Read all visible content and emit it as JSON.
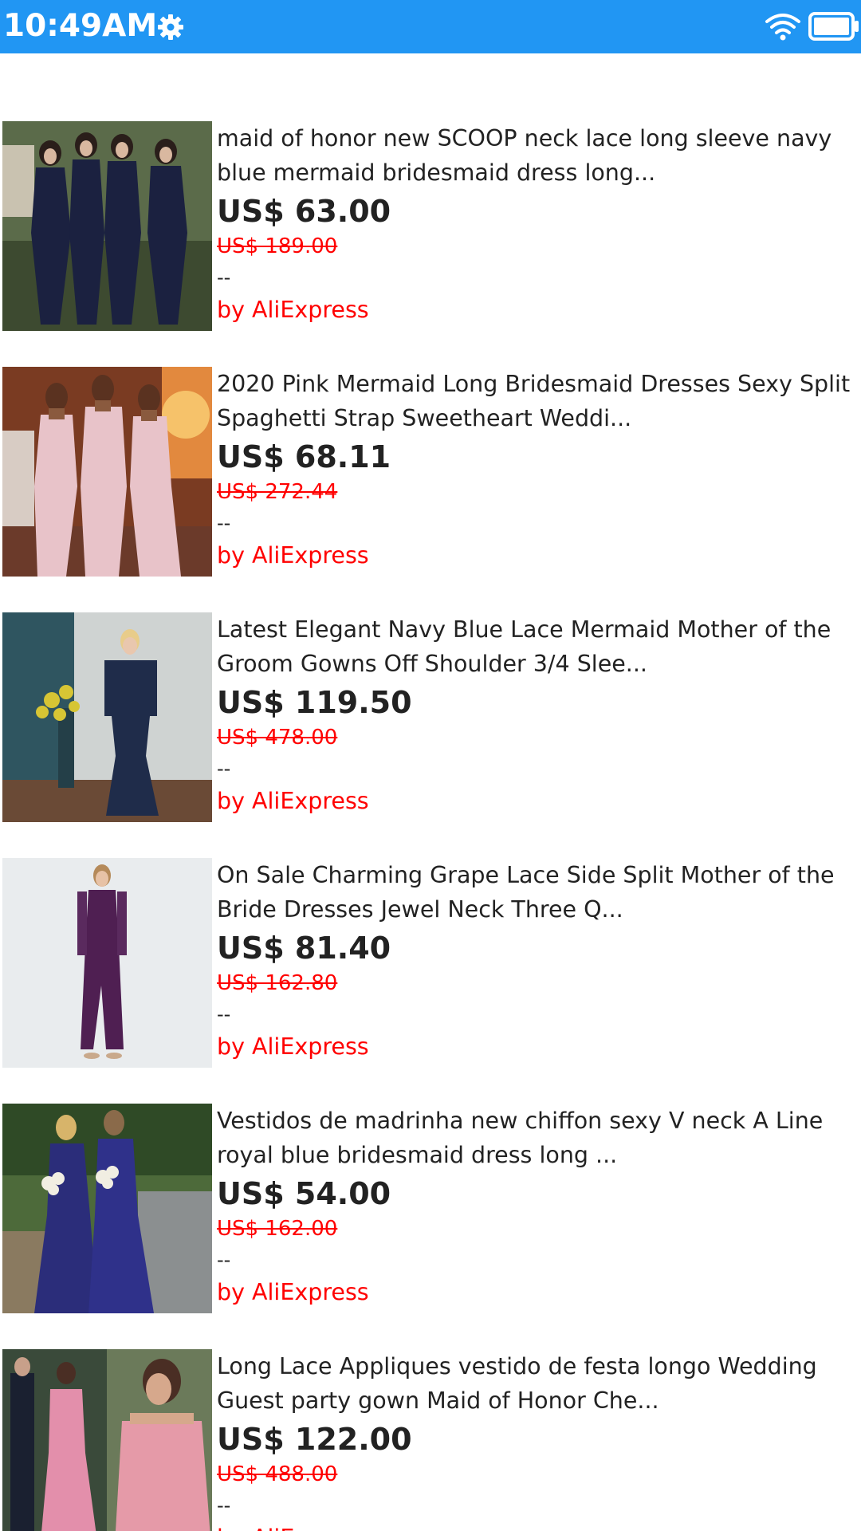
{
  "status_bar": {
    "time": "10:49AM",
    "settings_icon": "gear-icon",
    "wifi_icon": "wifi-icon",
    "battery_icon": "battery-icon",
    "background_color": "#2196F3"
  },
  "products": [
    {
      "title": "maid of honor new SCOOP neck lace long sleeve navy blue mermaid bridesmaid dress long...",
      "price": "US$ 63.00",
      "original_price": "US$ 189.00",
      "rating": "--",
      "seller": "by AliExpress"
    },
    {
      "title": "2020 Pink Mermaid Long Bridesmaid Dresses Sexy Split Spaghetti Strap Sweetheart Weddi...",
      "price": "US$ 68.11",
      "original_price": "US$ 272.44",
      "rating": "--",
      "seller": "by AliExpress"
    },
    {
      "title": "Latest Elegant Navy Blue Lace Mermaid Mother of the Groom Gowns Off Shoulder 3/4 Slee...",
      "price": "US$ 119.50",
      "original_price": "US$ 478.00",
      "rating": "--",
      "seller": "by AliExpress"
    },
    {
      "title": "On Sale Charming Grape Lace Side Split Mother of the Bride Dresses Jewel Neck Three Q...",
      "price": "US$ 81.40",
      "original_price": "US$ 162.80",
      "rating": "--",
      "seller": "by AliExpress"
    },
    {
      "title": "Vestidos de madrinha new chiffon sexy V neck A Line royal blue bridesmaid dress long ...",
      "price": "US$ 54.00",
      "original_price": "US$ 162.00",
      "rating": "--",
      "seller": "by AliExpress"
    },
    {
      "title": "Long Lace Appliques vestido de festa longo Wedding Guest party gown Maid of Honor Che...",
      "price": "US$ 122.00",
      "original_price": "US$ 488.00",
      "rating": "--",
      "seller": "by AliExpress"
    }
  ]
}
